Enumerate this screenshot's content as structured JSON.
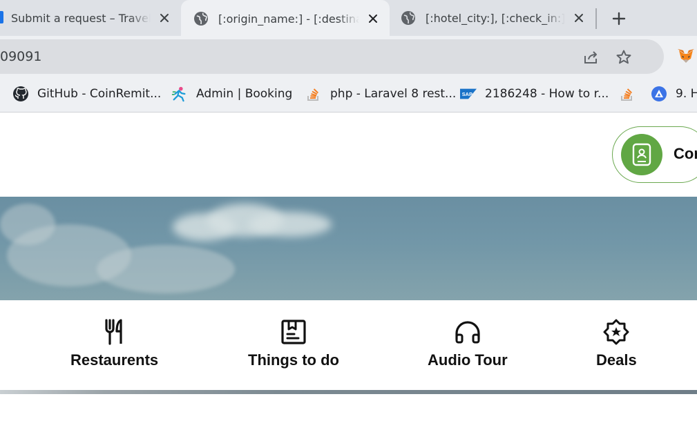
{
  "browser": {
    "tabs": [
      {
        "title": "Submit a request – Travelpayouts Help Center",
        "active": false
      },
      {
        "title": "[:origin_name:] - [:destination_name:]",
        "active": true
      },
      {
        "title": "[:hotel_city:], [:check_in:] - [:check_out:]",
        "active": false
      }
    ],
    "new_tab_symbol": "+",
    "close_symbol": "✕",
    "address_bar": {
      "url": "09091"
    },
    "bookmarks": [
      {
        "label": "GitHub - CoinRemit...",
        "icon": "github-icon"
      },
      {
        "label": "Admin | Booking",
        "icon": "runner-icon"
      },
      {
        "label": "php - Laravel 8 rest...",
        "icon": "stackoverflow-icon"
      },
      {
        "label": "2186248 - How to r...",
        "icon": "sap-icon"
      },
      {
        "label": "",
        "icon": "stackoverflow-icon"
      },
      {
        "label": "9. H",
        "icon": "triangle-app-icon"
      }
    ]
  },
  "page": {
    "contact": {
      "label": "Cor",
      "icon": "contact-book-icon",
      "accent": "#61a744"
    },
    "nav": [
      {
        "label": "Restaurents",
        "icon": "fork-knife-icon"
      },
      {
        "label": "Things to do",
        "icon": "ticket-box-icon"
      },
      {
        "label": "Audio Tour",
        "icon": "headphones-icon"
      },
      {
        "label": "Deals",
        "icon": "badge-star-icon"
      }
    ]
  }
}
